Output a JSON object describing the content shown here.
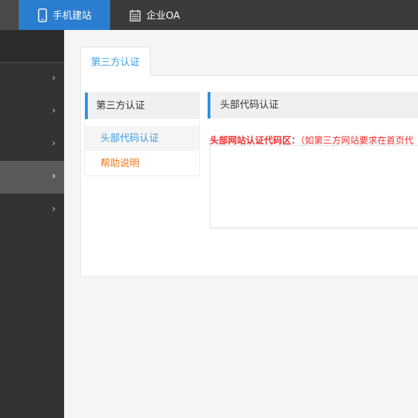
{
  "topnav": {
    "tabs": [
      {
        "label": "手机建站",
        "icon": "mobile-icon",
        "active": true
      },
      {
        "label": "企业OA",
        "icon": "calendar-icon"
      }
    ]
  },
  "sidebar": {
    "items": [
      {
        "icon": "chevron-right-icon"
      },
      {
        "icon": "chevron-right-icon"
      },
      {
        "icon": "chevron-right-icon"
      },
      {
        "icon": "chevron-right-icon",
        "active": true
      },
      {
        "icon": "chevron-right-icon"
      }
    ],
    "chevron": "›"
  },
  "main": {
    "tab": "第三方认证",
    "leftnav": {
      "title": "第三方认证",
      "items": [
        "头部代码认证",
        "帮助说明"
      ]
    },
    "section_title": "头部代码认证",
    "field_label_bold": "头部网站认证代码区：",
    "field_label_note": "（如第三方网站要求在首页代",
    "field_value": ""
  },
  "colors": {
    "accent": "#2a7dd0",
    "link": "#3a9ee4",
    "help": "#f07a1e",
    "label": "#f03030"
  }
}
